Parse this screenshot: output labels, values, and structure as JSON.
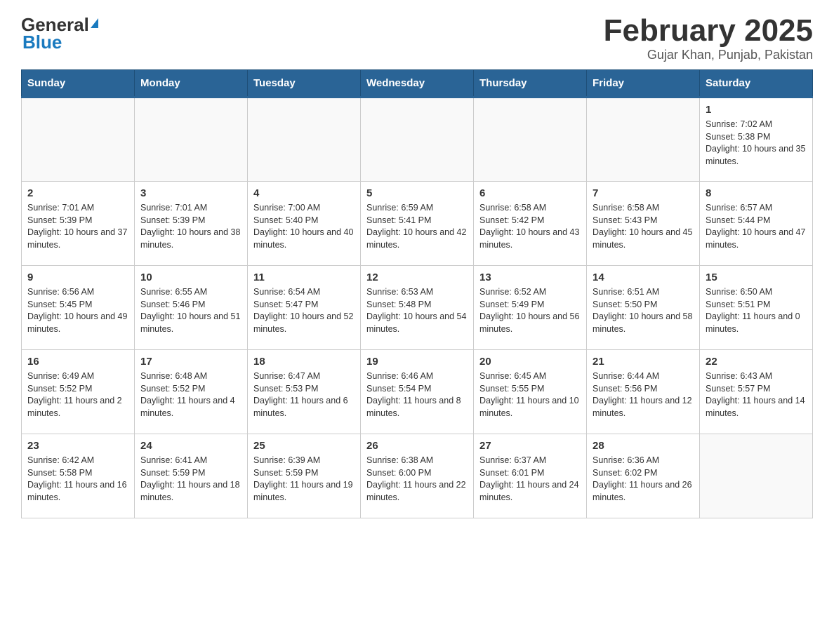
{
  "header": {
    "logo_general": "General",
    "logo_blue": "Blue",
    "title": "February 2025",
    "subtitle": "Gujar Khan, Punjab, Pakistan"
  },
  "days_of_week": [
    "Sunday",
    "Monday",
    "Tuesday",
    "Wednesday",
    "Thursday",
    "Friday",
    "Saturday"
  ],
  "weeks": [
    [
      {
        "day": "",
        "info": ""
      },
      {
        "day": "",
        "info": ""
      },
      {
        "day": "",
        "info": ""
      },
      {
        "day": "",
        "info": ""
      },
      {
        "day": "",
        "info": ""
      },
      {
        "day": "",
        "info": ""
      },
      {
        "day": "1",
        "info": "Sunrise: 7:02 AM\nSunset: 5:38 PM\nDaylight: 10 hours and 35 minutes."
      }
    ],
    [
      {
        "day": "2",
        "info": "Sunrise: 7:01 AM\nSunset: 5:39 PM\nDaylight: 10 hours and 37 minutes."
      },
      {
        "day": "3",
        "info": "Sunrise: 7:01 AM\nSunset: 5:39 PM\nDaylight: 10 hours and 38 minutes."
      },
      {
        "day": "4",
        "info": "Sunrise: 7:00 AM\nSunset: 5:40 PM\nDaylight: 10 hours and 40 minutes."
      },
      {
        "day": "5",
        "info": "Sunrise: 6:59 AM\nSunset: 5:41 PM\nDaylight: 10 hours and 42 minutes."
      },
      {
        "day": "6",
        "info": "Sunrise: 6:58 AM\nSunset: 5:42 PM\nDaylight: 10 hours and 43 minutes."
      },
      {
        "day": "7",
        "info": "Sunrise: 6:58 AM\nSunset: 5:43 PM\nDaylight: 10 hours and 45 minutes."
      },
      {
        "day": "8",
        "info": "Sunrise: 6:57 AM\nSunset: 5:44 PM\nDaylight: 10 hours and 47 minutes."
      }
    ],
    [
      {
        "day": "9",
        "info": "Sunrise: 6:56 AM\nSunset: 5:45 PM\nDaylight: 10 hours and 49 minutes."
      },
      {
        "day": "10",
        "info": "Sunrise: 6:55 AM\nSunset: 5:46 PM\nDaylight: 10 hours and 51 minutes."
      },
      {
        "day": "11",
        "info": "Sunrise: 6:54 AM\nSunset: 5:47 PM\nDaylight: 10 hours and 52 minutes."
      },
      {
        "day": "12",
        "info": "Sunrise: 6:53 AM\nSunset: 5:48 PM\nDaylight: 10 hours and 54 minutes."
      },
      {
        "day": "13",
        "info": "Sunrise: 6:52 AM\nSunset: 5:49 PM\nDaylight: 10 hours and 56 minutes."
      },
      {
        "day": "14",
        "info": "Sunrise: 6:51 AM\nSunset: 5:50 PM\nDaylight: 10 hours and 58 minutes."
      },
      {
        "day": "15",
        "info": "Sunrise: 6:50 AM\nSunset: 5:51 PM\nDaylight: 11 hours and 0 minutes."
      }
    ],
    [
      {
        "day": "16",
        "info": "Sunrise: 6:49 AM\nSunset: 5:52 PM\nDaylight: 11 hours and 2 minutes."
      },
      {
        "day": "17",
        "info": "Sunrise: 6:48 AM\nSunset: 5:52 PM\nDaylight: 11 hours and 4 minutes."
      },
      {
        "day": "18",
        "info": "Sunrise: 6:47 AM\nSunset: 5:53 PM\nDaylight: 11 hours and 6 minutes."
      },
      {
        "day": "19",
        "info": "Sunrise: 6:46 AM\nSunset: 5:54 PM\nDaylight: 11 hours and 8 minutes."
      },
      {
        "day": "20",
        "info": "Sunrise: 6:45 AM\nSunset: 5:55 PM\nDaylight: 11 hours and 10 minutes."
      },
      {
        "day": "21",
        "info": "Sunrise: 6:44 AM\nSunset: 5:56 PM\nDaylight: 11 hours and 12 minutes."
      },
      {
        "day": "22",
        "info": "Sunrise: 6:43 AM\nSunset: 5:57 PM\nDaylight: 11 hours and 14 minutes."
      }
    ],
    [
      {
        "day": "23",
        "info": "Sunrise: 6:42 AM\nSunset: 5:58 PM\nDaylight: 11 hours and 16 minutes."
      },
      {
        "day": "24",
        "info": "Sunrise: 6:41 AM\nSunset: 5:59 PM\nDaylight: 11 hours and 18 minutes."
      },
      {
        "day": "25",
        "info": "Sunrise: 6:39 AM\nSunset: 5:59 PM\nDaylight: 11 hours and 19 minutes."
      },
      {
        "day": "26",
        "info": "Sunrise: 6:38 AM\nSunset: 6:00 PM\nDaylight: 11 hours and 22 minutes."
      },
      {
        "day": "27",
        "info": "Sunrise: 6:37 AM\nSunset: 6:01 PM\nDaylight: 11 hours and 24 minutes."
      },
      {
        "day": "28",
        "info": "Sunrise: 6:36 AM\nSunset: 6:02 PM\nDaylight: 11 hours and 26 minutes."
      },
      {
        "day": "",
        "info": ""
      }
    ]
  ]
}
